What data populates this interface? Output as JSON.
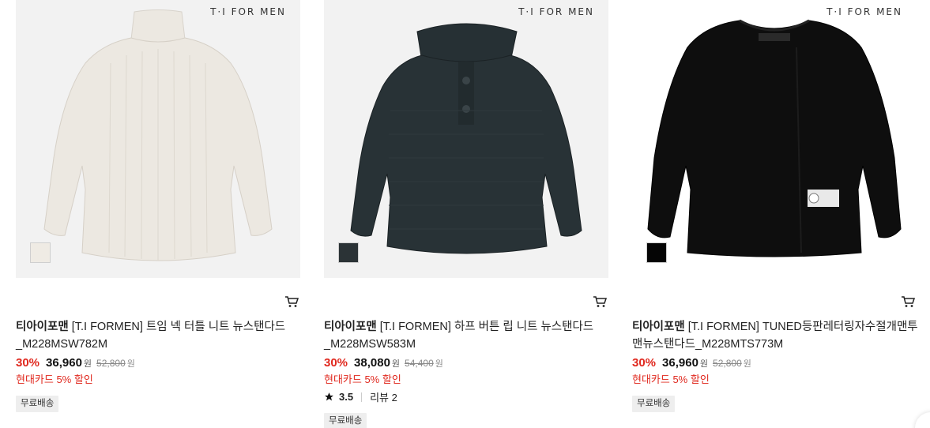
{
  "products": [
    {
      "brand_mark": "T·I FOR MEN",
      "brand": "티아이포맨",
      "name": "[T.I FORMEN] 트임 넥 터틀 니트 뉴스탠다드_M228MSW782M",
      "discount": "30%",
      "price": "36,960",
      "currency": "원",
      "original_price": "52,800",
      "promo": "현대카드 5% 할인",
      "shipping": "무료배송",
      "swatch_color": "#efebe4",
      "icon": "cart-icon"
    },
    {
      "brand_mark": "T·I FOR MEN",
      "brand": "티아이포맨",
      "name": "[T.I FORMEN] 하프 버튼 립 니트 뉴스탠다드_M228MSW583M",
      "discount": "30%",
      "price": "38,080",
      "currency": "원",
      "original_price": "54,400",
      "promo": "현대카드 5% 할인",
      "rating": "3.5",
      "reviews": "리뷰 2",
      "shipping": "무료배송",
      "swatch_color": "#2b3336",
      "icon": "cart-icon"
    },
    {
      "brand_mark": "T·I FOR MEN",
      "brand": "티아이포맨",
      "name": "[T.I FORMEN] TUNED등판레터링자수절개맨투맨뉴스탠다드_M228MTS773M",
      "discount": "30%",
      "price": "36,960",
      "currency": "원",
      "original_price": "52,800",
      "promo": "현대카드 5% 할인",
      "shipping": "무료배송",
      "swatch_color": "#050505",
      "icon": "cart-icon"
    }
  ],
  "colors": {
    "discount": "#e0281e",
    "promo": "#e0281e",
    "thumb_bg": "#f2f2f2"
  }
}
